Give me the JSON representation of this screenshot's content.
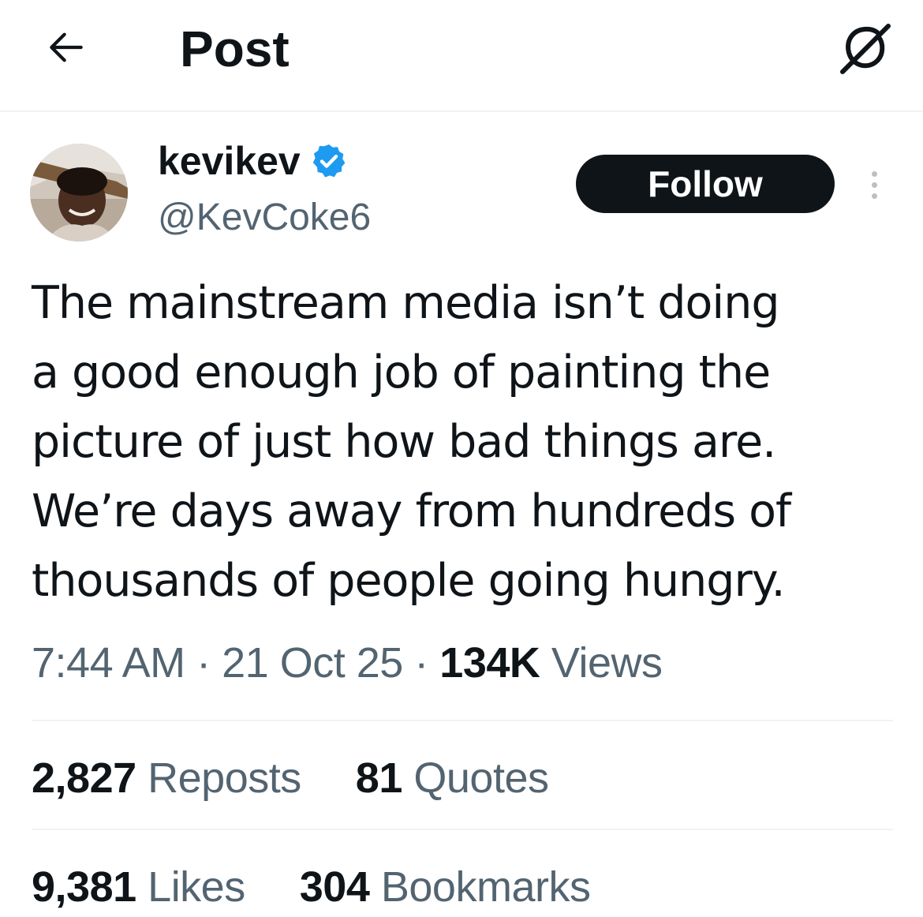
{
  "header": {
    "title": "Post",
    "back_icon": "arrow-left-icon",
    "grok_icon": "grok-icon"
  },
  "author": {
    "display_name": "kevikev",
    "handle": "@KevCoke6",
    "verified": true,
    "verified_color": "#1d9bf0"
  },
  "follow_button": {
    "label": "Follow"
  },
  "tweet": {
    "text": "The mainstream media isn’t doing\na good enough job of painting the\npicture of just how bad things are.\nWe’re days away from hundreds of\nthousands of people going hungry."
  },
  "meta": {
    "time": "7:44 AM",
    "separator": "·",
    "date": "21 Oct 25",
    "views_count": "134K",
    "views_label": "Views"
  },
  "stats": {
    "reposts_count": "2,827",
    "reposts_label": "Reposts",
    "quotes_count": "81",
    "quotes_label": "Quotes",
    "likes_count": "9,381",
    "likes_label": "Likes",
    "bookmarks_count": "304",
    "bookmarks_label": "Bookmarks"
  },
  "colors": {
    "text_primary": "#0f1419",
    "text_secondary": "#536471",
    "divider": "#eff3f4",
    "accent": "#1d9bf0"
  }
}
